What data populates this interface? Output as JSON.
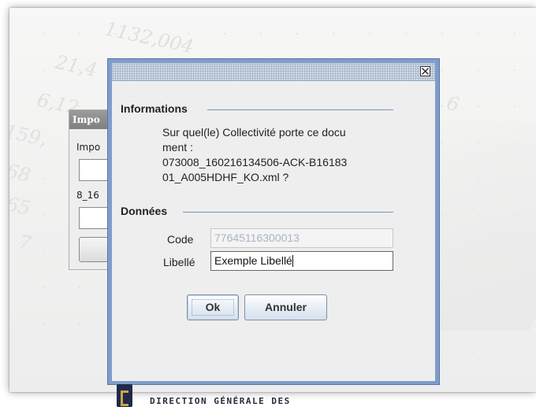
{
  "background": {
    "numbers": [
      "1132,004",
      "21,4",
      "6,12",
      "159,",
      "68",
      "65",
      "7",
      "6"
    ]
  },
  "import_window": {
    "title": "Impo",
    "label1": "Impo",
    "label2": "8_16"
  },
  "dialog": {
    "close_icon": "close-icon",
    "informations": {
      "title": "Informations",
      "lines": [
        "Sur quel(le) Collectivité porte ce docu",
        "ment :",
        "073008_160216134506-ACK-B16183",
        "01_A005HDHF_KO.xml ?"
      ]
    },
    "donnees": {
      "title": "Données",
      "code_label": "Code",
      "code_value": "77645116300013",
      "libelle_label": "Libellé",
      "libelle_value": "Exemple Libellé"
    },
    "buttons": {
      "ok": "Ok",
      "cancel": "Annuler"
    }
  },
  "footer": {
    "text": "DIRECTION GÉNÉRALE DES"
  },
  "colors": {
    "dialog_frame": "#7f9dc9",
    "section_line": "#7a93c0",
    "disabled_text": "#a9b4c4"
  }
}
